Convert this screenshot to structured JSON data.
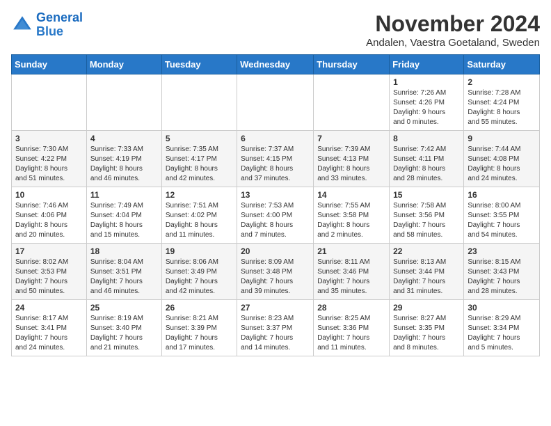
{
  "logo": {
    "line1": "General",
    "line2": "Blue"
  },
  "title": "November 2024",
  "subtitle": "Andalen, Vaestra Goetaland, Sweden",
  "weekdays": [
    "Sunday",
    "Monday",
    "Tuesday",
    "Wednesday",
    "Thursday",
    "Friday",
    "Saturday"
  ],
  "weeks": [
    [
      {
        "day": "",
        "info": ""
      },
      {
        "day": "",
        "info": ""
      },
      {
        "day": "",
        "info": ""
      },
      {
        "day": "",
        "info": ""
      },
      {
        "day": "",
        "info": ""
      },
      {
        "day": "1",
        "info": "Sunrise: 7:26 AM\nSunset: 4:26 PM\nDaylight: 9 hours\nand 0 minutes."
      },
      {
        "day": "2",
        "info": "Sunrise: 7:28 AM\nSunset: 4:24 PM\nDaylight: 8 hours\nand 55 minutes."
      }
    ],
    [
      {
        "day": "3",
        "info": "Sunrise: 7:30 AM\nSunset: 4:22 PM\nDaylight: 8 hours\nand 51 minutes."
      },
      {
        "day": "4",
        "info": "Sunrise: 7:33 AM\nSunset: 4:19 PM\nDaylight: 8 hours\nand 46 minutes."
      },
      {
        "day": "5",
        "info": "Sunrise: 7:35 AM\nSunset: 4:17 PM\nDaylight: 8 hours\nand 42 minutes."
      },
      {
        "day": "6",
        "info": "Sunrise: 7:37 AM\nSunset: 4:15 PM\nDaylight: 8 hours\nand 37 minutes."
      },
      {
        "day": "7",
        "info": "Sunrise: 7:39 AM\nSunset: 4:13 PM\nDaylight: 8 hours\nand 33 minutes."
      },
      {
        "day": "8",
        "info": "Sunrise: 7:42 AM\nSunset: 4:11 PM\nDaylight: 8 hours\nand 28 minutes."
      },
      {
        "day": "9",
        "info": "Sunrise: 7:44 AM\nSunset: 4:08 PM\nDaylight: 8 hours\nand 24 minutes."
      }
    ],
    [
      {
        "day": "10",
        "info": "Sunrise: 7:46 AM\nSunset: 4:06 PM\nDaylight: 8 hours\nand 20 minutes."
      },
      {
        "day": "11",
        "info": "Sunrise: 7:49 AM\nSunset: 4:04 PM\nDaylight: 8 hours\nand 15 minutes."
      },
      {
        "day": "12",
        "info": "Sunrise: 7:51 AM\nSunset: 4:02 PM\nDaylight: 8 hours\nand 11 minutes."
      },
      {
        "day": "13",
        "info": "Sunrise: 7:53 AM\nSunset: 4:00 PM\nDaylight: 8 hours\nand 7 minutes."
      },
      {
        "day": "14",
        "info": "Sunrise: 7:55 AM\nSunset: 3:58 PM\nDaylight: 8 hours\nand 2 minutes."
      },
      {
        "day": "15",
        "info": "Sunrise: 7:58 AM\nSunset: 3:56 PM\nDaylight: 7 hours\nand 58 minutes."
      },
      {
        "day": "16",
        "info": "Sunrise: 8:00 AM\nSunset: 3:55 PM\nDaylight: 7 hours\nand 54 minutes."
      }
    ],
    [
      {
        "day": "17",
        "info": "Sunrise: 8:02 AM\nSunset: 3:53 PM\nDaylight: 7 hours\nand 50 minutes."
      },
      {
        "day": "18",
        "info": "Sunrise: 8:04 AM\nSunset: 3:51 PM\nDaylight: 7 hours\nand 46 minutes."
      },
      {
        "day": "19",
        "info": "Sunrise: 8:06 AM\nSunset: 3:49 PM\nDaylight: 7 hours\nand 42 minutes."
      },
      {
        "day": "20",
        "info": "Sunrise: 8:09 AM\nSunset: 3:48 PM\nDaylight: 7 hours\nand 39 minutes."
      },
      {
        "day": "21",
        "info": "Sunrise: 8:11 AM\nSunset: 3:46 PM\nDaylight: 7 hours\nand 35 minutes."
      },
      {
        "day": "22",
        "info": "Sunrise: 8:13 AM\nSunset: 3:44 PM\nDaylight: 7 hours\nand 31 minutes."
      },
      {
        "day": "23",
        "info": "Sunrise: 8:15 AM\nSunset: 3:43 PM\nDaylight: 7 hours\nand 28 minutes."
      }
    ],
    [
      {
        "day": "24",
        "info": "Sunrise: 8:17 AM\nSunset: 3:41 PM\nDaylight: 7 hours\nand 24 minutes."
      },
      {
        "day": "25",
        "info": "Sunrise: 8:19 AM\nSunset: 3:40 PM\nDaylight: 7 hours\nand 21 minutes."
      },
      {
        "day": "26",
        "info": "Sunrise: 8:21 AM\nSunset: 3:39 PM\nDaylight: 7 hours\nand 17 minutes."
      },
      {
        "day": "27",
        "info": "Sunrise: 8:23 AM\nSunset: 3:37 PM\nDaylight: 7 hours\nand 14 minutes."
      },
      {
        "day": "28",
        "info": "Sunrise: 8:25 AM\nSunset: 3:36 PM\nDaylight: 7 hours\nand 11 minutes."
      },
      {
        "day": "29",
        "info": "Sunrise: 8:27 AM\nSunset: 3:35 PM\nDaylight: 7 hours\nand 8 minutes."
      },
      {
        "day": "30",
        "info": "Sunrise: 8:29 AM\nSunset: 3:34 PM\nDaylight: 7 hours\nand 5 minutes."
      }
    ]
  ]
}
